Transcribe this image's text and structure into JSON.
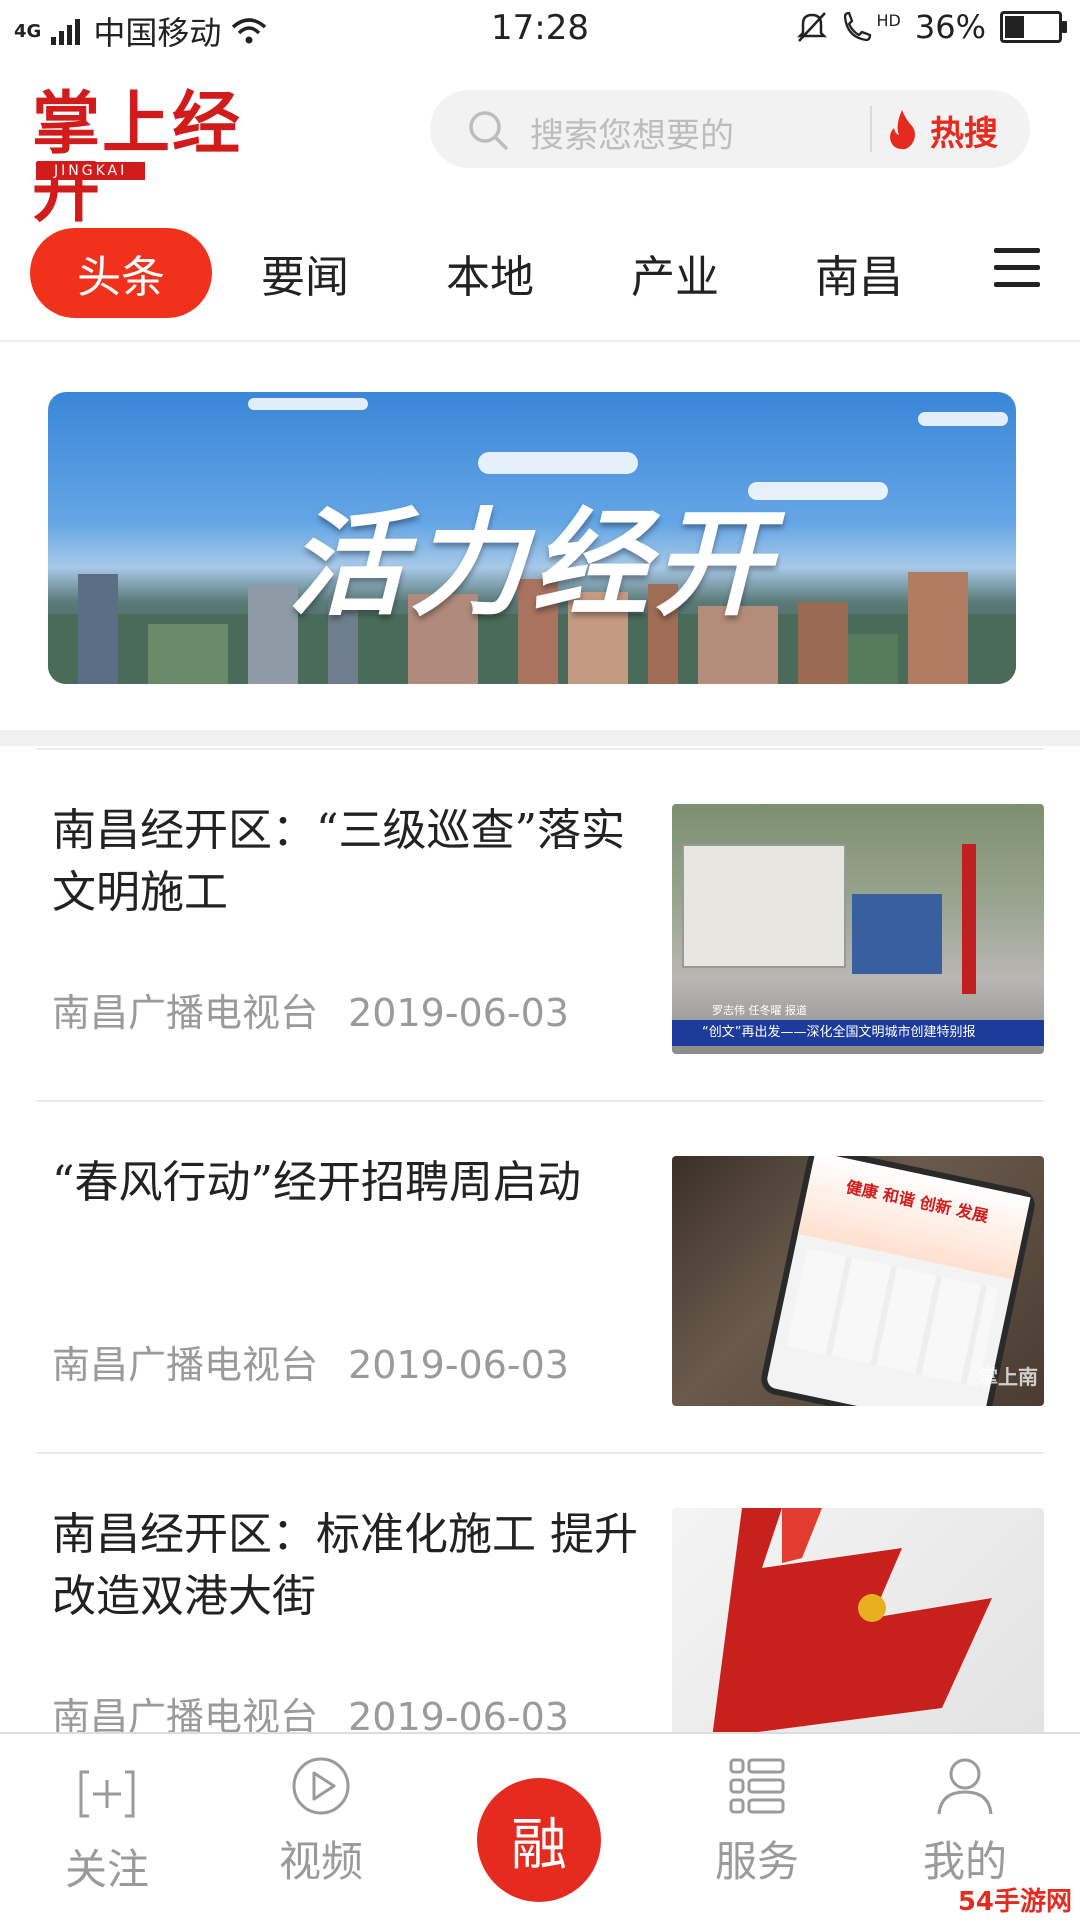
{
  "status_bar": {
    "network": "4G",
    "carrier": "中国移动",
    "time": "17:28",
    "battery": "36%",
    "battery_level": 0.36,
    "hd_label": "HD"
  },
  "header": {
    "logo_text": "掌上经开",
    "logo_sub": "JINGKAI",
    "search_placeholder": "搜索您想要的",
    "hot_label": "热搜"
  },
  "tabs": [
    "头条",
    "要闻",
    "本地",
    "产业",
    "南昌"
  ],
  "banner": {
    "title": "活力经开"
  },
  "news": [
    {
      "title": "南昌经开区：“三级巡查”落实文明施工",
      "source": "南昌广播电视台",
      "date": "2019-06-03",
      "thumb_caption_1": "罗志伟  任冬曜  报道",
      "thumb_caption_2": "“创文”再出发——深化全国文明城市创建特别报"
    },
    {
      "title": "“春风行动”经开招聘周启动",
      "source": "南昌广播电视台",
      "date": "2019-06-03",
      "thumb_caption_1": "健康 和谐 创新 发展",
      "thumb_caption_2": "掌上南"
    },
    {
      "title": "南昌经开区：标准化施工 提升改造双港大街",
      "source": "南昌广播电视台",
      "date": "2019-06-03"
    }
  ],
  "bottom_nav": {
    "follow": "关注",
    "video": "视频",
    "center": "融",
    "service": "服务",
    "mine": "我的"
  },
  "watermark": "54手游网",
  "colors": {
    "accent": "#e52b1f",
    "tab_active": "#f0321c",
    "logo": "#d21b1b"
  }
}
